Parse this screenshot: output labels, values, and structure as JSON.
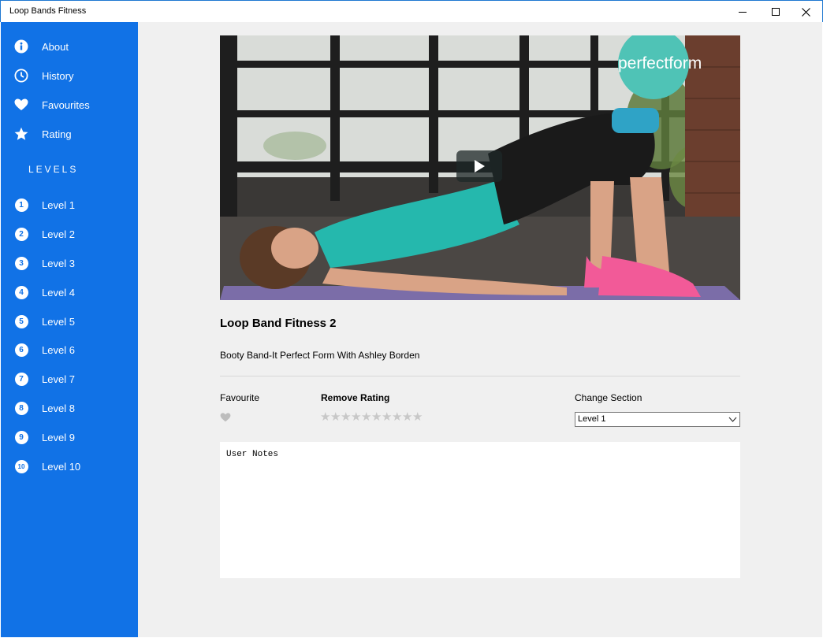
{
  "window": {
    "title": "Loop Bands Fitness"
  },
  "sidebar": {
    "items": [
      {
        "label": "About",
        "icon": "info-icon"
      },
      {
        "label": "History",
        "icon": "clock-icon"
      },
      {
        "label": "Favourites",
        "icon": "heart-icon"
      },
      {
        "label": "Rating",
        "icon": "star-icon"
      }
    ],
    "levels_heading": "LEVELS",
    "levels": [
      {
        "num": "1",
        "label": "Level 1"
      },
      {
        "num": "2",
        "label": "Level 2"
      },
      {
        "num": "3",
        "label": "Level 3"
      },
      {
        "num": "4",
        "label": "Level 4"
      },
      {
        "num": "5",
        "label": "Level 5"
      },
      {
        "num": "6",
        "label": "Level 6"
      },
      {
        "num": "7",
        "label": "Level 7"
      },
      {
        "num": "8",
        "label": "Level 8"
      },
      {
        "num": "9",
        "label": "Level 9"
      },
      {
        "num": "10",
        "label": "Level 10"
      }
    ]
  },
  "video": {
    "watermark": "perfectform"
  },
  "exercise": {
    "title": "Loop Band Fitness 2",
    "description": "Booty Band-It Perfect Form With Ashley Borden"
  },
  "controls": {
    "favourite_label": "Favourite",
    "rating_label": "Remove Rating",
    "rating": {
      "value": 0,
      "max": 10
    },
    "section_label": "Change Section",
    "section_value": "Level 1"
  },
  "notes": {
    "placeholder": "User Notes",
    "value": ""
  },
  "colors": {
    "sidebar": "#1172e6",
    "main_bg": "#f0f0f0",
    "star_empty": "#c8c8c8",
    "heart": "#bdbdbd"
  }
}
